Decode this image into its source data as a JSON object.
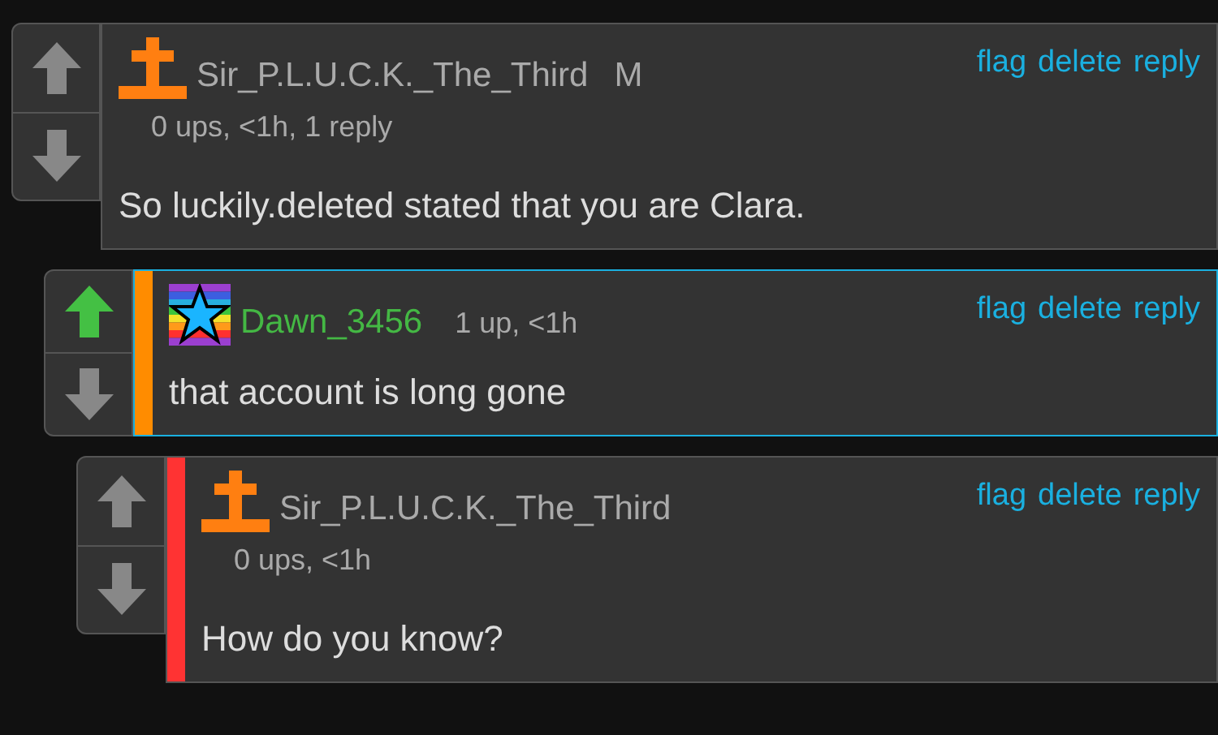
{
  "comments": [
    {
      "kind": "full",
      "avatar": {
        "kind": "cross"
      },
      "user": "Sir_P.L.U.C.K._The_Third",
      "badge": "M",
      "meta": "0 ups, <1h, 1 reply",
      "text": "So luckily.deleted stated that you are Clara.",
      "upvoted": false,
      "highlighted": false,
      "actions": [
        "flag",
        "delete",
        "reply"
      ],
      "children": [
        {
          "kind": "compact",
          "avatar": {
            "kind": "star"
          },
          "user": "Dawn_3456",
          "meta": "1 up, <1h",
          "text": "that account is long gone",
          "upvoted": true,
          "highlighted": true,
          "color": "#ff8c00",
          "actions": [
            "flag",
            "delete",
            "reply"
          ],
          "children": [
            {
              "kind": "full",
              "avatar": {
                "kind": "cross"
              },
              "user": "Sir_P.L.U.C.K._The_Third",
              "meta": "0 ups, <1h",
              "text": "How do you know?",
              "upvoted": false,
              "highlighted": false,
              "color": "#ff3333",
              "actions": [
                "flag",
                "delete",
                "reply"
              ]
            }
          ]
        }
      ]
    }
  ]
}
